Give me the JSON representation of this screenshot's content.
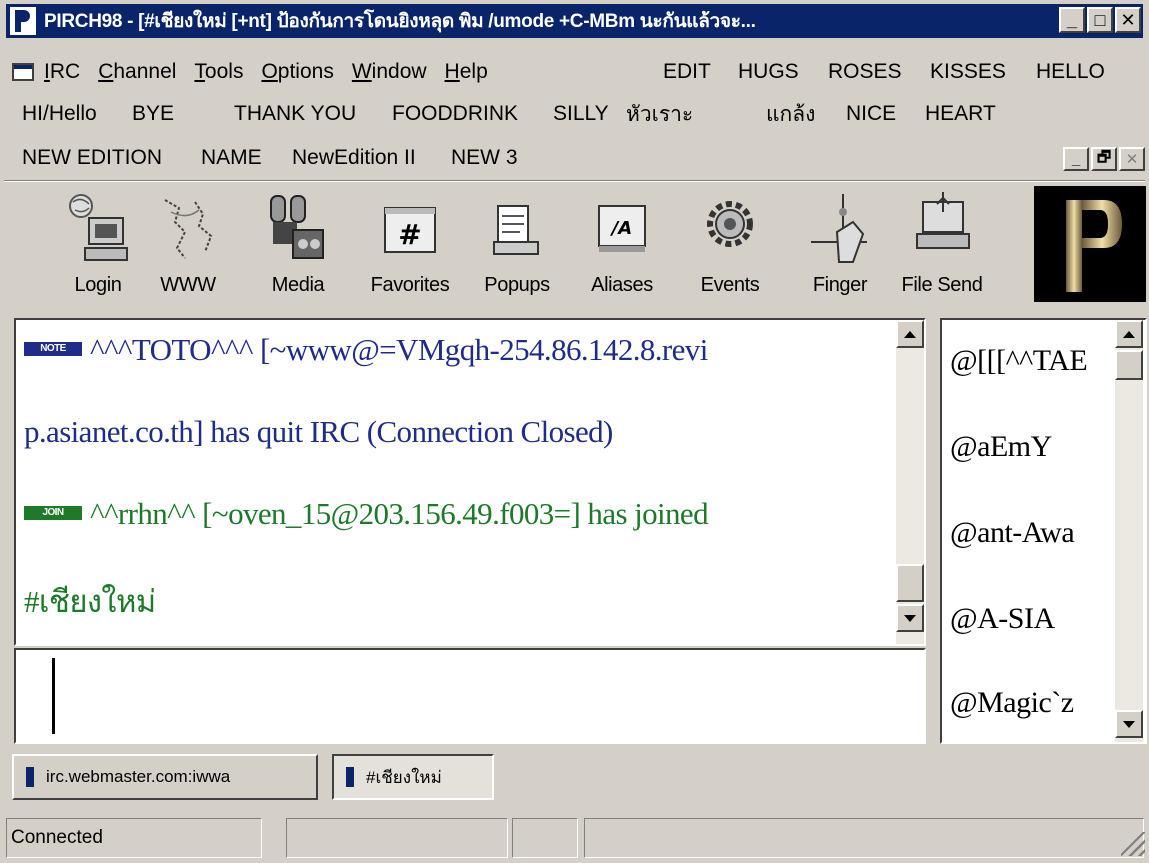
{
  "window": {
    "title": "PIRCH98 - [#เชียงใหม่ [+nt] ป้องกันการโดนยิงหลุด พิม /umode +C-MBm นะกันแล้วจะ...",
    "minimize_glyph": "_",
    "maximize_glyph": "□",
    "close_glyph": "✕"
  },
  "menu": {
    "items": [
      {
        "label": "IRC",
        "accel": "I",
        "rest": "RC"
      },
      {
        "label": "Channel",
        "accel": "C",
        "rest": "hannel"
      },
      {
        "label": "Tools",
        "accel": "T",
        "rest": "ools"
      },
      {
        "label": "Options",
        "accel": "O",
        "rest": "ptions"
      },
      {
        "label": "Window",
        "accel": "W",
        "rest": "indow"
      },
      {
        "label": "Help",
        "accel": "H",
        "rest": "elp"
      }
    ]
  },
  "aliases": {
    "row1": [
      "EDIT",
      "HUGS",
      "ROSES",
      "KISSES",
      "HELLO"
    ],
    "row2": [
      "HI/Hello",
      "BYE",
      "THANK YOU",
      "FOODDRINK",
      "SILLY",
      "หัวเราะ",
      "แกล้ง",
      "NICE",
      "HEART"
    ],
    "row3": [
      "NEW EDITION",
      "NAME",
      "NewEdition II",
      "NEW 3"
    ]
  },
  "mdi_controls": {
    "minimize": "_",
    "restore": "🗗",
    "close": "✕"
  },
  "toolbar": {
    "buttons": [
      {
        "label": "Login",
        "icon": "login-computer-icon"
      },
      {
        "label": "WWW",
        "icon": "www-map-icon"
      },
      {
        "label": "Media",
        "icon": "media-icon"
      },
      {
        "label": "Favorites",
        "icon": "favorites-hash-icon",
        "glyph": "#"
      },
      {
        "label": "Popups",
        "icon": "popups-icon"
      },
      {
        "label": "Aliases",
        "icon": "aliases-icon",
        "glyph": "/A"
      },
      {
        "label": "Events",
        "icon": "events-gear-icon"
      },
      {
        "label": "Finger",
        "icon": "finger-icon"
      },
      {
        "label": "File Send",
        "icon": "file-send-icon"
      }
    ]
  },
  "chat": {
    "lines": [
      {
        "badge": "NOTE",
        "text": "^^^TOTO^^^ [~www@=VMgqh-254.86.142.8.revi"
      },
      {
        "badge": "",
        "text": "p.asianet.co.th] has quit IRC (Connection Closed)"
      },
      {
        "badge": "JOIN",
        "text": "^^rrhn^^ [~oven_15@203.156.49.f003=] has joined"
      },
      {
        "badge": "",
        "text": "#เชียงใหม่"
      }
    ],
    "colors": {
      "note": "#1f2c8a",
      "join": "#1e7a2a",
      "note_badge": "#1f2c8a",
      "join_badge": "#1e7a2a"
    }
  },
  "nicklist": {
    "nicks": [
      "@[[[^^TAE",
      "@aEmY",
      "@ant-Awa",
      "@A-SIA",
      "@Magic`z"
    ]
  },
  "tabs": [
    {
      "label": "irc.webmaster.com:iwwa",
      "active": false
    },
    {
      "label": "#เชียงใหม่",
      "active": true
    }
  ],
  "status": {
    "text": "Connected"
  }
}
